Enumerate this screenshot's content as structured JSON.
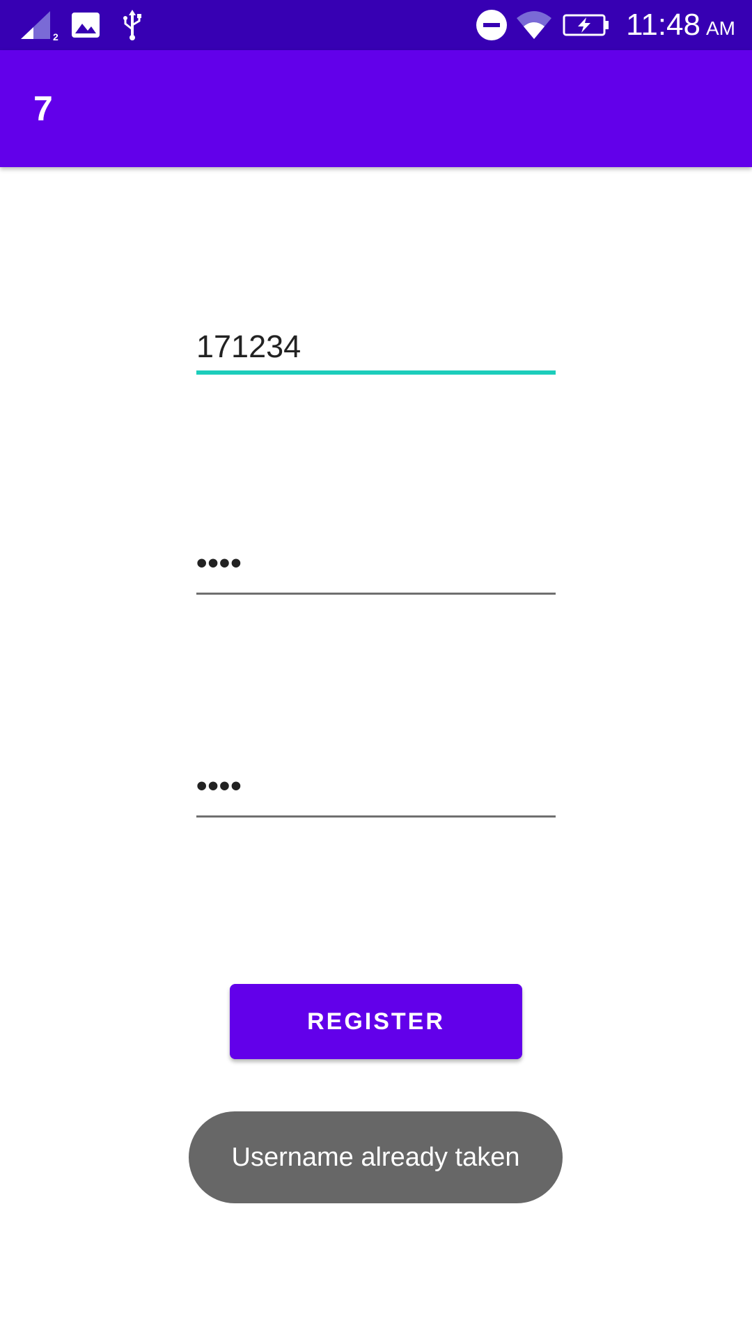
{
  "status_bar": {
    "time": "11:48",
    "ampm": "AM",
    "icons": [
      "signal-icon",
      "image-icon",
      "usb-icon",
      "do-not-disturb-icon",
      "wifi-icon",
      "battery-charging-icon"
    ],
    "signal_sim_label": "2"
  },
  "app_bar": {
    "title": "7"
  },
  "form": {
    "username_value": "171234",
    "password_value": "••••",
    "confirm_password_value": "••••"
  },
  "register_button": {
    "label": "REGISTER"
  },
  "toast": {
    "message": "Username already taken"
  },
  "colors": {
    "status_bar": "#3700b3",
    "primary": "#6200ea",
    "accent": "#1ccdbb",
    "toast": "#676767"
  }
}
